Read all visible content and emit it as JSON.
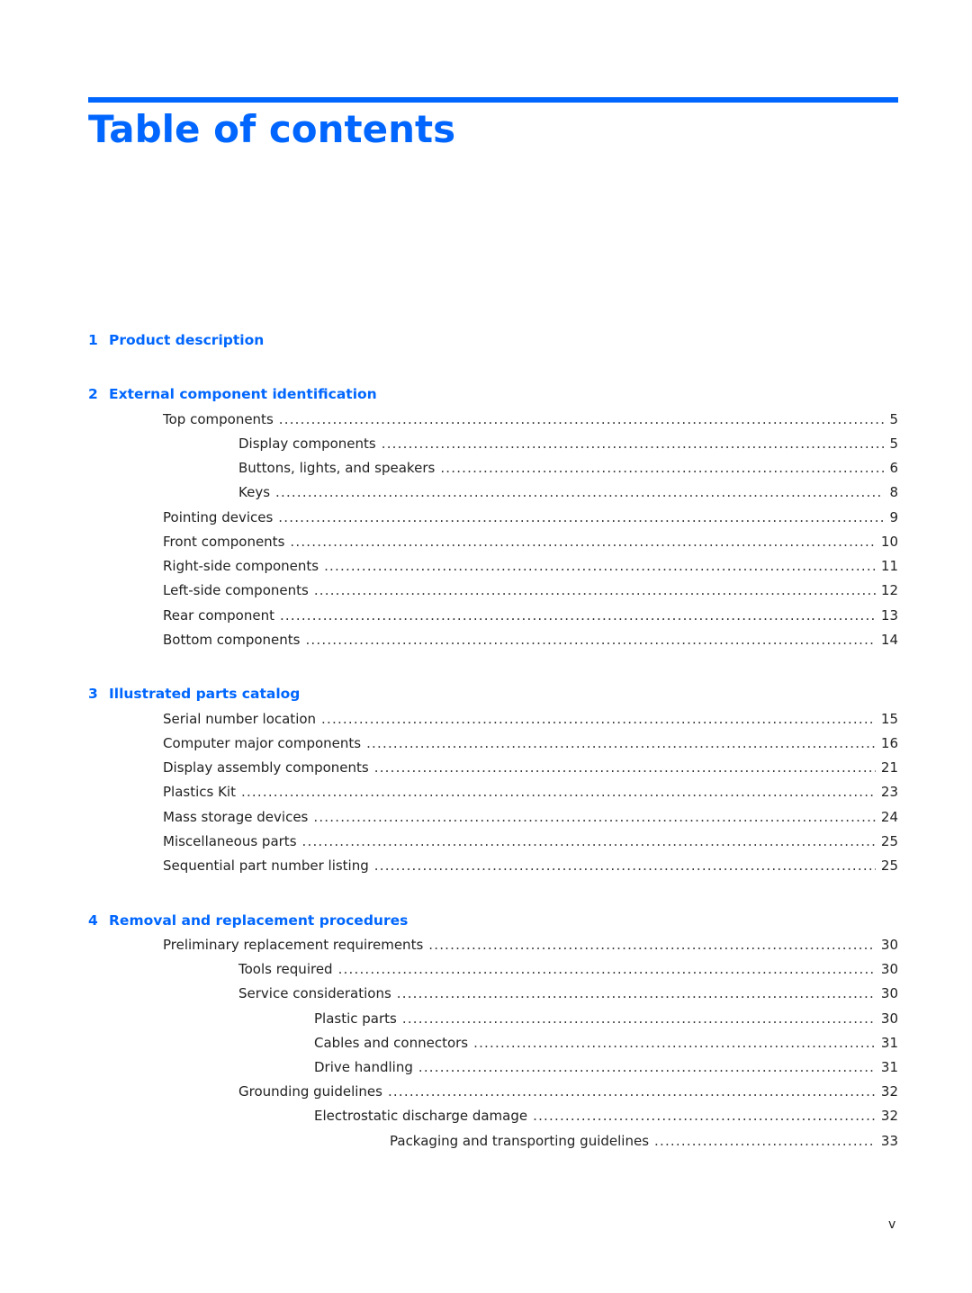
{
  "page": {
    "title": "Table of contents",
    "footer_page_number": "v",
    "accent_color": "#0066ff"
  },
  "chapters": [
    {
      "number": "1",
      "title": "Product description",
      "entries": []
    },
    {
      "number": "2",
      "title": "External component identification",
      "entries": [
        {
          "level": 1,
          "label": "Top components",
          "page": "5"
        },
        {
          "level": 2,
          "label": "Display components",
          "page": "5"
        },
        {
          "level": 2,
          "label": "Buttons, lights, and speakers",
          "page": "6"
        },
        {
          "level": 2,
          "label": "Keys",
          "page": "8"
        },
        {
          "level": 1,
          "label": "Pointing devices",
          "page": "9"
        },
        {
          "level": 1,
          "label": "Front components",
          "page": "10"
        },
        {
          "level": 1,
          "label": "Right-side components",
          "page": "11"
        },
        {
          "level": 1,
          "label": "Left-side components",
          "page": "12"
        },
        {
          "level": 1,
          "label": "Rear component",
          "page": "13"
        },
        {
          "level": 1,
          "label": "Bottom components",
          "page": "14"
        }
      ]
    },
    {
      "number": "3",
      "title": "Illustrated parts catalog",
      "entries": [
        {
          "level": 1,
          "label": "Serial number location",
          "page": "15"
        },
        {
          "level": 1,
          "label": "Computer major components",
          "page": "16"
        },
        {
          "level": 1,
          "label": "Display assembly components",
          "page": "21"
        },
        {
          "level": 1,
          "label": "Plastics Kit",
          "page": "23"
        },
        {
          "level": 1,
          "label": "Mass storage devices",
          "page": "24"
        },
        {
          "level": 1,
          "label": "Miscellaneous parts",
          "page": "25"
        },
        {
          "level": 1,
          "label": "Sequential part number listing",
          "page": "25"
        }
      ]
    },
    {
      "number": "4",
      "title": "Removal and replacement procedures",
      "entries": [
        {
          "level": 1,
          "label": "Preliminary replacement requirements",
          "page": "30"
        },
        {
          "level": 2,
          "label": "Tools required",
          "page": "30"
        },
        {
          "level": 2,
          "label": "Service considerations",
          "page": "30"
        },
        {
          "level": 3,
          "label": "Plastic parts",
          "page": "30"
        },
        {
          "level": 3,
          "label": "Cables and connectors",
          "page": "31"
        },
        {
          "level": 3,
          "label": "Drive handling",
          "page": "31"
        },
        {
          "level": 2,
          "label": "Grounding guidelines",
          "page": "32"
        },
        {
          "level": 3,
          "label": "Electrostatic discharge damage",
          "page": "32"
        },
        {
          "level": 4,
          "label": "Packaging and transporting guidelines",
          "page": "33"
        }
      ]
    }
  ]
}
